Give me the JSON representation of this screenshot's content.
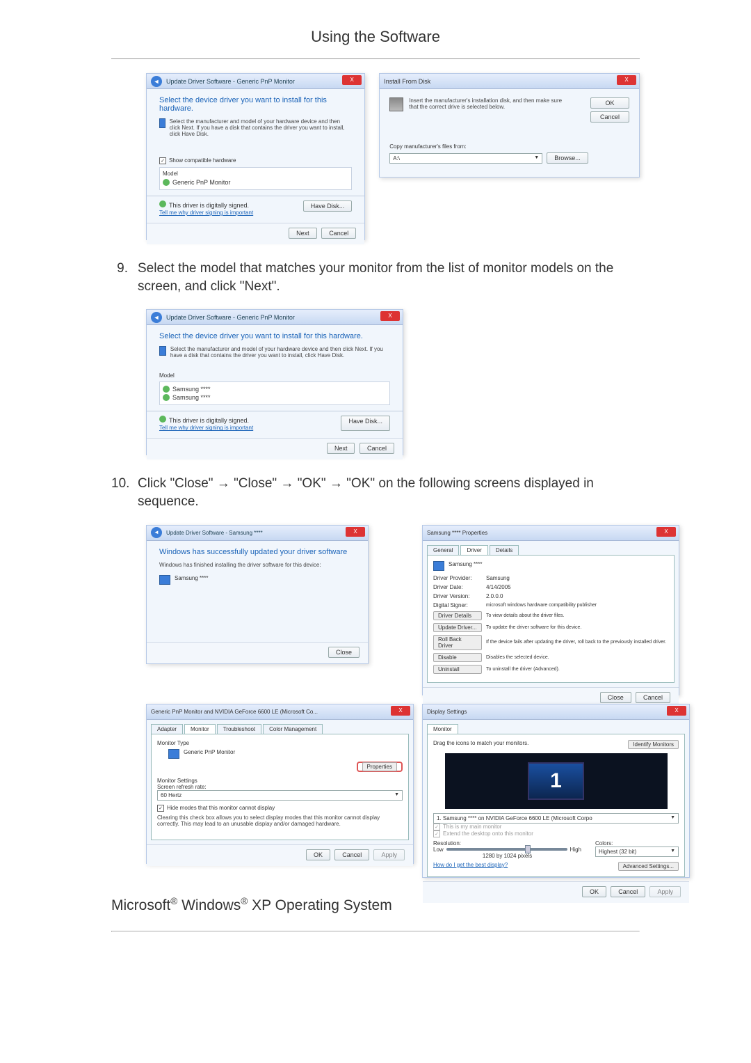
{
  "page": {
    "title": "Using the Software"
  },
  "step9": {
    "num": "9.",
    "text": "Select the model that matches your monitor from the list of monitor models on the screen, and click \"Next\"."
  },
  "step10": {
    "num": "10.",
    "text": "Click \"Close\" → \"Close\" → \"OK\" → \"OK\" on the following screens displayed in sequence."
  },
  "dlg_select_driver": {
    "breadcrumb": "Update Driver Software - Generic PnP Monitor",
    "headline": "Select the device driver you want to install for this hardware.",
    "subtext": "Select the manufacturer and model of your hardware device and then click Next. If you have a disk that contains the driver you want to install, click Have Disk.",
    "show_compat": "Show compatible hardware",
    "model_header": "Model",
    "model_generic": "Generic PnP Monitor",
    "model_samsung_a": "Samsung ****",
    "model_samsung_b": "Samsung ****",
    "signed": "This driver is digitally signed.",
    "tell_me": "Tell me why driver signing is important",
    "have_disk": "Have Disk...",
    "next": "Next",
    "cancel": "Cancel"
  },
  "dlg_install_from_disk": {
    "title": "Install From Disk",
    "instruction": "Insert the manufacturer's installation disk, and then make sure that the correct drive is selected below.",
    "ok": "OK",
    "cancel": "Cancel",
    "copy_label": "Copy manufacturer's files from:",
    "browse": "Browse...",
    "path": "A:\\"
  },
  "dlg_success": {
    "breadcrumb": "Update Driver Software - Samsung ****",
    "headline": "Windows has successfully updated your driver software",
    "subtext": "Windows has finished installing the driver software for this device:",
    "device": "Samsung ****",
    "close": "Close"
  },
  "dlg_props_driver": {
    "title": "Samsung **** Properties",
    "tabs": {
      "general": "General",
      "driver": "Driver",
      "details": "Details"
    },
    "device": "Samsung ****",
    "rows": {
      "provider_l": "Driver Provider:",
      "provider_v": "Samsung",
      "date_l": "Driver Date:",
      "date_v": "4/14/2005",
      "version_l": "Driver Version:",
      "version_v": "2.0.0.0",
      "signer_l": "Digital Signer:",
      "signer_v": "microsoft windows hardware compatibility publisher"
    },
    "buttons": {
      "details": "Driver Details",
      "details_t": "To view details about the driver files.",
      "update": "Update Driver...",
      "update_t": "To update the driver software for this device.",
      "rollback": "Roll Back Driver",
      "rollback_t": "If the device fails after updating the driver, roll back to the previously installed driver.",
      "disable": "Disable",
      "disable_t": "Disables the selected device.",
      "uninstall": "Uninstall",
      "uninstall_t": "To uninstall the driver (Advanced)."
    },
    "close": "Close",
    "cancel": "Cancel"
  },
  "dlg_monitor_props": {
    "title": "Generic PnP Monitor and NVIDIA GeForce 6600 LE (Microsoft Co...",
    "tabs": {
      "adapter": "Adapter",
      "monitor": "Monitor",
      "troubleshoot": "Troubleshoot",
      "color": "Color Management"
    },
    "type_group": "Monitor Type",
    "type_value": "Generic PnP Monitor",
    "properties": "Properties",
    "settings_group": "Monitor Settings",
    "refresh_label": "Screen refresh rate:",
    "refresh_value": "60 Hertz",
    "hide_label": "Hide modes that this monitor cannot display",
    "warn": "Clearing this check box allows you to select display modes that this monitor cannot display correctly. This may lead to an unusable display and/or damaged hardware.",
    "ok": "OK",
    "cancel": "Cancel",
    "apply": "Apply"
  },
  "dlg_display_settings": {
    "title": "Display Settings",
    "tab": "Monitor",
    "drag": "Drag the icons to match your monitors.",
    "identify": "Identify Monitors",
    "monitor_num": "1",
    "select_known": "1. Samsung **** on NVIDIA GeForce 6600 LE (Microsoft Corpo",
    "this_main": "This is my main monitor",
    "extend": "Extend the desktop onto this monitor",
    "resolution_l": "Resolution:",
    "colors_l": "Colors:",
    "low": "Low",
    "high": "High",
    "res_value": "1280 by 1024 pixels",
    "colors_value": "Highest (32 bit)",
    "best": "How do I get the best display?",
    "advanced": "Advanced Settings...",
    "ok": "OK",
    "cancel": "Cancel",
    "apply": "Apply"
  },
  "footer": {
    "ms": "Microsoft",
    "r": "®",
    "win": " Windows",
    "xp": " XP Operating System"
  }
}
